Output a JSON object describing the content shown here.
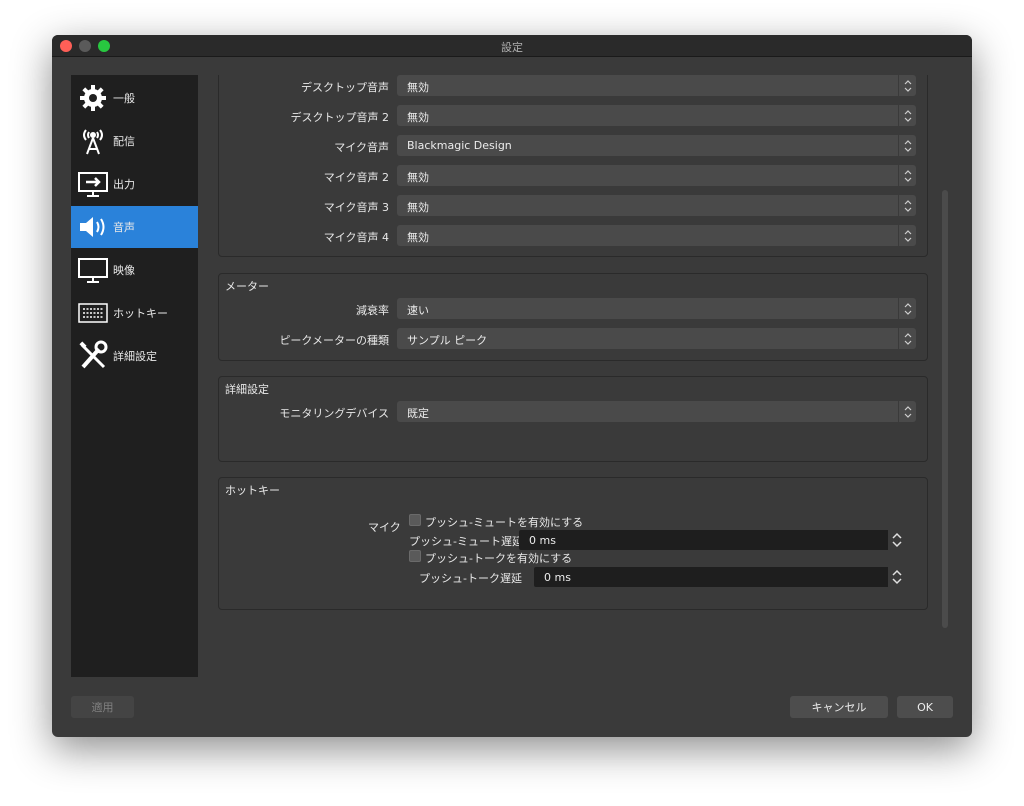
{
  "window": {
    "title": "設定"
  },
  "sidebar": {
    "items": [
      {
        "label": "一般",
        "icon": "gear-icon"
      },
      {
        "label": "配信",
        "icon": "broadcast-antenna-icon"
      },
      {
        "label": "出力",
        "icon": "output-monitor-icon"
      },
      {
        "label": "音声",
        "icon": "speaker-icon",
        "active": true
      },
      {
        "label": "映像",
        "icon": "monitor-icon"
      },
      {
        "label": "ホットキー",
        "icon": "keyboard-icon"
      },
      {
        "label": "詳細設定",
        "icon": "tools-icon"
      }
    ]
  },
  "devices": {
    "rows": [
      {
        "label": "デスクトップ音声",
        "value": "無効"
      },
      {
        "label": "デスクトップ音声 2",
        "value": "無効"
      },
      {
        "label": "マイク音声",
        "value": "Blackmagic Design"
      },
      {
        "label": "マイク音声 2",
        "value": "無効"
      },
      {
        "label": "マイク音声 3",
        "value": "無効"
      },
      {
        "label": "マイク音声 4",
        "value": "無効"
      }
    ]
  },
  "meter": {
    "title": "メーター",
    "decay_label": "減衰率",
    "decay_value": "速い",
    "peak_label": "ピークメーターの種類",
    "peak_value": "サンプル ピーク"
  },
  "advanced": {
    "title": "詳細設定",
    "monitor_label": "モニタリングデバイス",
    "monitor_value": "既定"
  },
  "hotkeys": {
    "title": "ホットキー",
    "mic_label": "マイク",
    "push_mute_label": "プッシュ-ミュートを有効にする",
    "push_mute_delay_label": "プッシュ-ミュート遅延",
    "push_mute_delay_value": "0 ms",
    "push_talk_label": "プッシュ-トークを有効にする",
    "push_talk_delay_label": "プッシュ-トーク遅延",
    "push_talk_delay_value": "0 ms"
  },
  "footer": {
    "apply_label": "適用",
    "cancel_label": "キャンセル",
    "ok_label": "OK"
  },
  "colors": {
    "accent": "#2a82da",
    "background": "#3a3a3a",
    "sidebar": "#1f1f1f"
  }
}
